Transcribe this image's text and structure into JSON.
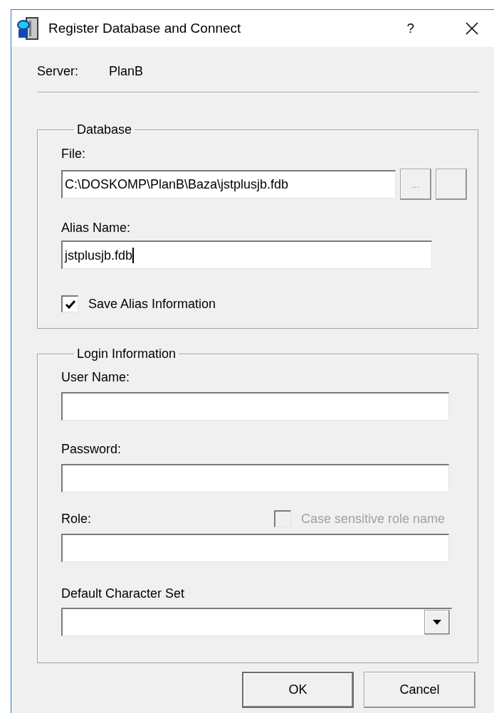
{
  "window": {
    "title": "Register Database and Connect",
    "help_button": "?"
  },
  "server": {
    "label": "Server:",
    "value": "PlanB"
  },
  "database": {
    "title": "Database",
    "file": {
      "label": "File:",
      "value": "C:\\DOSKOMP\\PlanB\\Baza\\jstplusjb.fdb"
    },
    "browse_button": {
      "label": "...",
      "disabled": true
    },
    "alias": {
      "label": "Alias Name:",
      "value": "jstplusjb.fdb",
      "focused": true
    },
    "save_alias": {
      "label": "Save Alias Information",
      "checked": true,
      "disabled": false
    }
  },
  "login": {
    "title": "Login Information",
    "fields": [
      {
        "kind": "text",
        "label": "User Name:"
      },
      {
        "kind": "text",
        "label": "Password:"
      },
      {
        "kind": "role",
        "label": "Role:",
        "option": {
          "label": "Case sensitive role name",
          "checked": false,
          "disabled": true
        }
      },
      {
        "kind": "combo",
        "label": "Default Character Set"
      }
    ]
  },
  "buttons": [
    {
      "label": "OK",
      "default": true
    },
    {
      "label": "Cancel",
      "default": false
    }
  ]
}
